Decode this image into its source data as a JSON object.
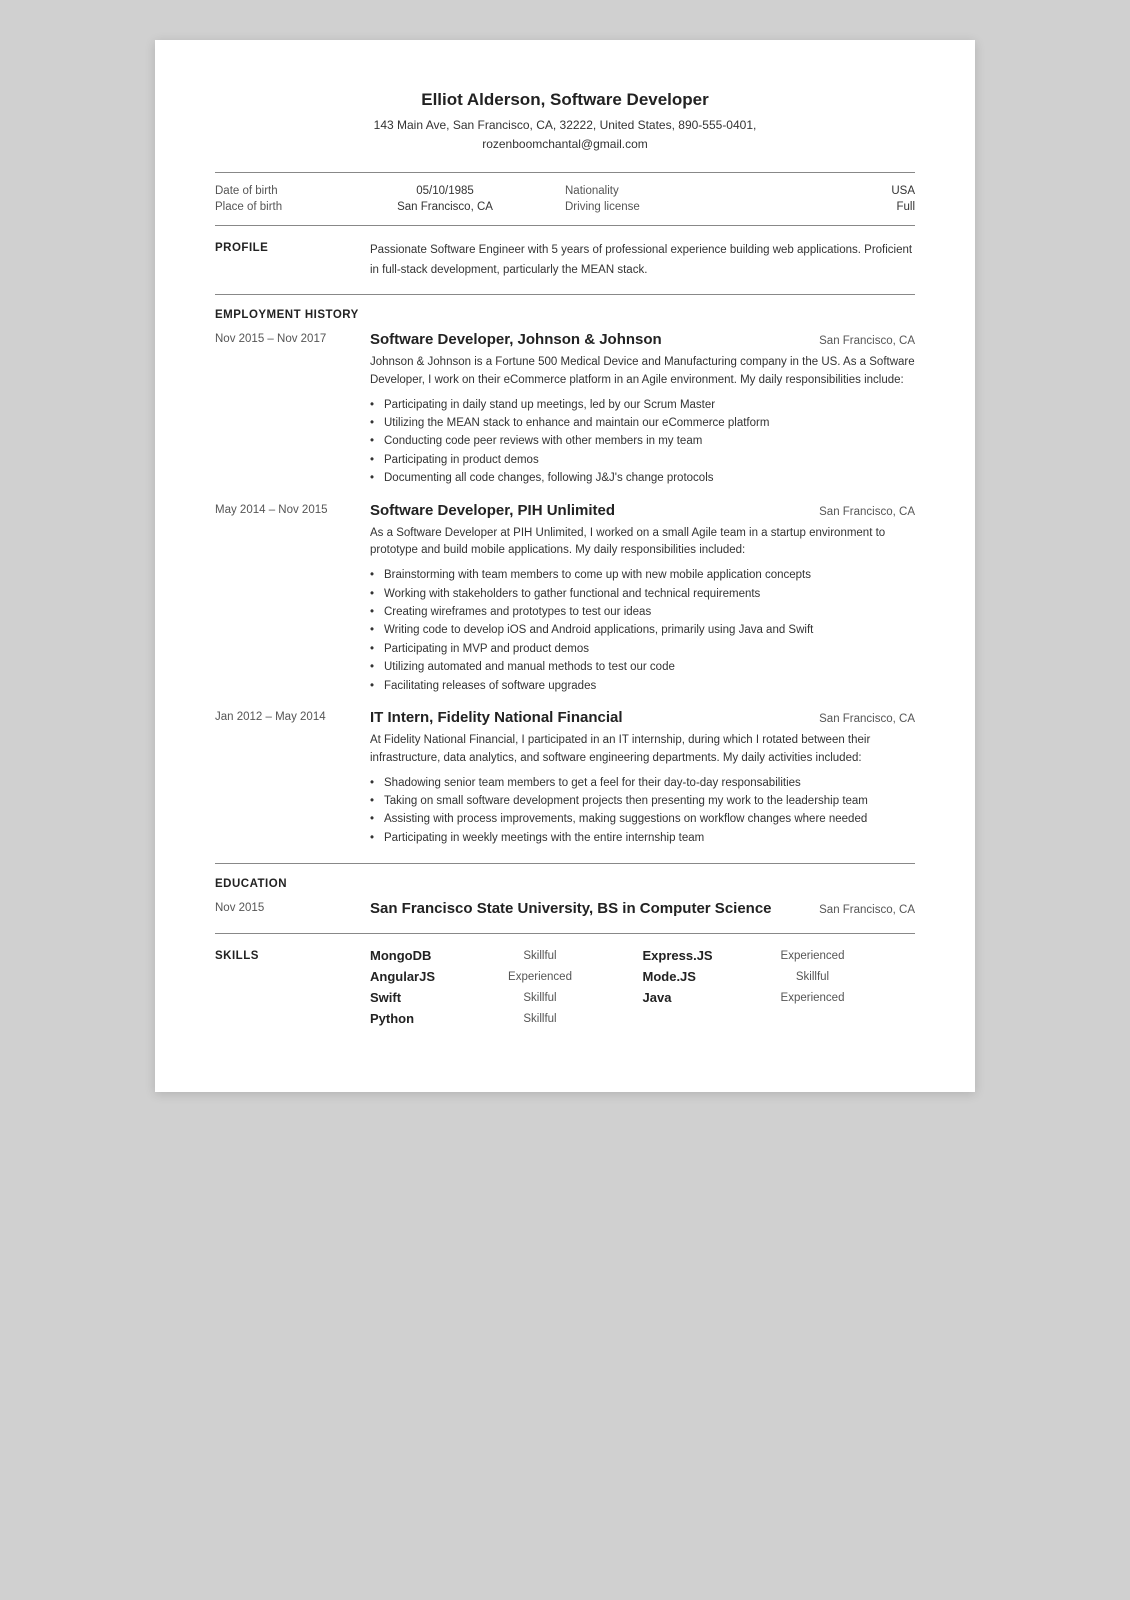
{
  "header": {
    "name": "Elliot Alderson, Software Developer",
    "address": "143 Main Ave, San Francisco, CA, 32222, United States, 890-555-0401,",
    "email": "rozenboomchantal@gmail.com"
  },
  "personal": {
    "dob_label": "Date of birth",
    "dob_value": "05/10/1985",
    "nationality_label": "Nationality",
    "nationality_value": "USA",
    "pob_label": "Place of birth",
    "pob_value": "San Francisco, CA",
    "driving_label": "Driving license",
    "driving_value": "Full"
  },
  "profile": {
    "section_label": "PROFILE",
    "text": "Passionate Software Engineer with 5 years of professional experience building web applications. Proficient in full-stack development, particularly the MEAN stack."
  },
  "employment": {
    "section_label": "EMPLOYMENT HISTORY",
    "jobs": [
      {
        "date": "Nov 2015 – Nov 2017",
        "title": "Software Developer, Johnson & Johnson",
        "location": "San Francisco, CA",
        "description": "Johnson & Johnson is a Fortune 500 Medical Device and Manufacturing company in the US. As a Software Developer, I work on their eCommerce platform in an Agile environment. My daily responsibilities include:",
        "bullets": [
          "Participating in daily stand up meetings, led by our Scrum Master",
          "Utilizing the MEAN stack to enhance and maintain our eCommerce platform",
          "Conducting code peer reviews with other members in my team",
          "Participating in product demos",
          "Documenting all code changes, following J&J's change protocols"
        ]
      },
      {
        "date": "May 2014 – Nov 2015",
        "title": "Software Developer, PIH Unlimited",
        "location": "San Francisco, CA",
        "description": "As a Software Developer at PIH Unlimited, I worked on a small Agile team in a startup environment to prototype and build mobile applications. My daily responsibilities included:",
        "bullets": [
          "Brainstorming with team members to come up with new mobile application concepts",
          "Working with stakeholders to gather functional and technical requirements",
          "Creating wireframes and prototypes to test our ideas",
          "Writing code to develop iOS and Android applications, primarily using Java and Swift",
          "Participating in MVP and product demos",
          "Utilizing automated and manual methods to test our code",
          "Facilitating releases of software upgrades"
        ]
      },
      {
        "date": "Jan 2012 – May 2014",
        "title": "IT Intern, Fidelity National Financial",
        "location": "San Francisco, CA",
        "description": "At Fidelity National Financial, I participated in an IT internship, during which I rotated between their infrastructure, data analytics, and software engineering departments. My daily activities included:",
        "bullets": [
          "Shadowing senior team members to get a feel for their day-to-day responsabilities",
          "Taking on small software development projects then presenting my work to the leadership team",
          "Assisting with process improvements, making suggestions on workflow changes where needed",
          "Participating in weekly meetings with the entire internship team"
        ]
      }
    ]
  },
  "education": {
    "section_label": "EDUCATION",
    "entries": [
      {
        "date": "Nov 2015",
        "title": "San Francisco State University, BS in Computer Science",
        "location": "San Francisco, CA"
      }
    ]
  },
  "skills": {
    "section_label": "SKILLS",
    "items": [
      {
        "name": "MongoDB",
        "level": "Skillful"
      },
      {
        "name": "Express.JS",
        "level": "Experienced"
      },
      {
        "name": "AngularJS",
        "level": "Experienced"
      },
      {
        "name": "Mode.JS",
        "level": "Skillful"
      },
      {
        "name": "Swift",
        "level": "Skillful"
      },
      {
        "name": "Java",
        "level": "Experienced"
      },
      {
        "name": "Python",
        "level": "Skillful"
      }
    ]
  }
}
